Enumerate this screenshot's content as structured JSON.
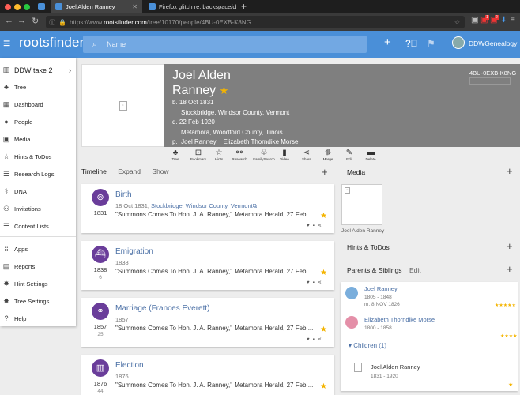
{
  "browser": {
    "tabs": [
      {
        "label": "Joel Alden Ranney"
      },
      {
        "label": "Firefox glitch re: backspace/de"
      }
    ],
    "url_prefix": "https://www.",
    "url_domain": "rootsfinder.com",
    "url_path": "/tree/10170/people/4BU-0EXB-K8NG",
    "badges": [
      "1",
      "2"
    ]
  },
  "app": {
    "logo": "rootsfinder",
    "search_placeholder": "Name",
    "username": "DDWGenealogy"
  },
  "sidebar": {
    "tree_name": "DDW take 2",
    "items": [
      {
        "label": "Tree",
        "icon": "tree-icon"
      },
      {
        "label": "Dashboard",
        "icon": "dashboard-icon"
      },
      {
        "label": "People",
        "icon": "person-icon"
      },
      {
        "label": "Media",
        "icon": "media-icon"
      },
      {
        "label": "Hints & ToDos",
        "icon": "star-icon"
      },
      {
        "label": "Research Logs",
        "icon": "list-icon"
      },
      {
        "label": "DNA",
        "icon": "dna-icon"
      },
      {
        "label": "Invitations",
        "icon": "group-icon"
      },
      {
        "label": "Content Lists",
        "icon": "list-icon"
      },
      {
        "label": "Apps",
        "icon": "apps-icon"
      },
      {
        "label": "Reports",
        "icon": "report-icon"
      },
      {
        "label": "Hint Settings",
        "icon": "settings-icon"
      },
      {
        "label": "Tree Settings",
        "icon": "settings-icon"
      },
      {
        "label": "Help",
        "icon": "help-icon"
      }
    ]
  },
  "person": {
    "name_line1": "Joel Alden",
    "name_line2": "Ranney",
    "birth": "b. 18 Oct 1831",
    "birth_place": "Stockbridge, Windsor County, Vermont",
    "death": "d. 22 Feb 1920",
    "death_place": "Metamora, Woodford County, Illinois",
    "parents": "p.  Joel Ranney    Elizabeth Thorndike Morse",
    "id": "4BU-0EXB-K8NG"
  },
  "actions": [
    "Tree",
    "Bookmark",
    "Hints",
    "Research",
    "FamilySearch",
    "Video",
    "Share",
    "Merge",
    "Edit",
    "Delete"
  ],
  "timeline_tabs": [
    "Timeline",
    "Expand",
    "Show"
  ],
  "events": [
    {
      "title": "Birth",
      "year": "1831",
      "age": "",
      "date": "18 Oct 1831, ",
      "place": "Stockbridge, Windsor County, Vermont",
      "source": "\"Summons Comes To Hon. J. A. Ranney,\" Metamora Herald, 27 Feb ..."
    },
    {
      "title": "Emigration",
      "year": "1838",
      "age": "6",
      "date": "1838",
      "place": "",
      "source": "\"Summons Comes To Hon. J. A. Ranney,\" Metamora Herald, 27 Feb ..."
    },
    {
      "title": "Marriage",
      "spouse": "Frances Everett",
      "year": "1857",
      "age": "25",
      "date": "1857",
      "place": "",
      "source": "\"Summons Comes To Hon. J. A. Ranney,\" Metamora Herald, 27 Feb ..."
    },
    {
      "title": "Election",
      "year": "1876",
      "age": "44",
      "date": "1876",
      "place": "",
      "source": "\"Summons Comes To Hon. J. A. Ranney,\" Metamora Herald, 27 Feb ..."
    }
  ],
  "right": {
    "media_title": "Media",
    "media_caption": "Joel Alden Ranney",
    "hints_title": "Hints & ToDos",
    "parents_title": "Parents & Siblings",
    "parents_edit": "Edit",
    "father": {
      "name": "Joel Ranney",
      "dates": "1805 - 1848",
      "marriage": "m. 8 NOV 1826",
      "stars": "★★★★★"
    },
    "mother": {
      "name": "Elizabeth Thorndike Morse",
      "dates": "1800 - 1858",
      "stars": "★★★★"
    },
    "children_label": "Children (1)",
    "child": {
      "name": "Joel Alden Ranney",
      "dates": "1831 - 1920"
    }
  }
}
